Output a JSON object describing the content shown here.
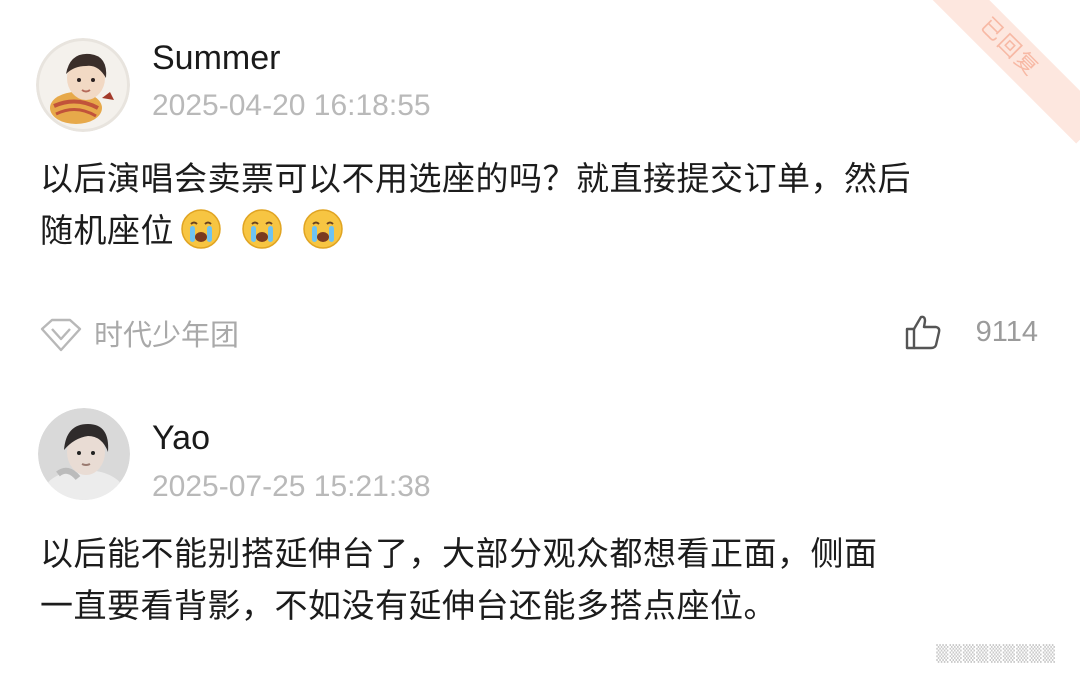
{
  "comments": [
    {
      "username": "Summer",
      "timestamp": "2025-04-20 16:18:55",
      "text_line1": "以后演唱会卖票可以不用选座的吗？就直接提交订单，然后",
      "text_line2": "随机座位",
      "emoji": "crying-emoji",
      "emoji_count": 3,
      "group_tag": "时代少年团",
      "likes": "9114",
      "replied_badge": "已回复"
    },
    {
      "username": "Yao",
      "timestamp": "2025-07-25 15:21:38",
      "text_line1": "以后能不能别搭延伸台了，大部分观众都想看正面，侧面",
      "text_line2": "一直要看背影，不如没有延伸台还能多搭点座位。"
    }
  ],
  "watermark": "▒▒▒▒▒▒▒▒▒"
}
